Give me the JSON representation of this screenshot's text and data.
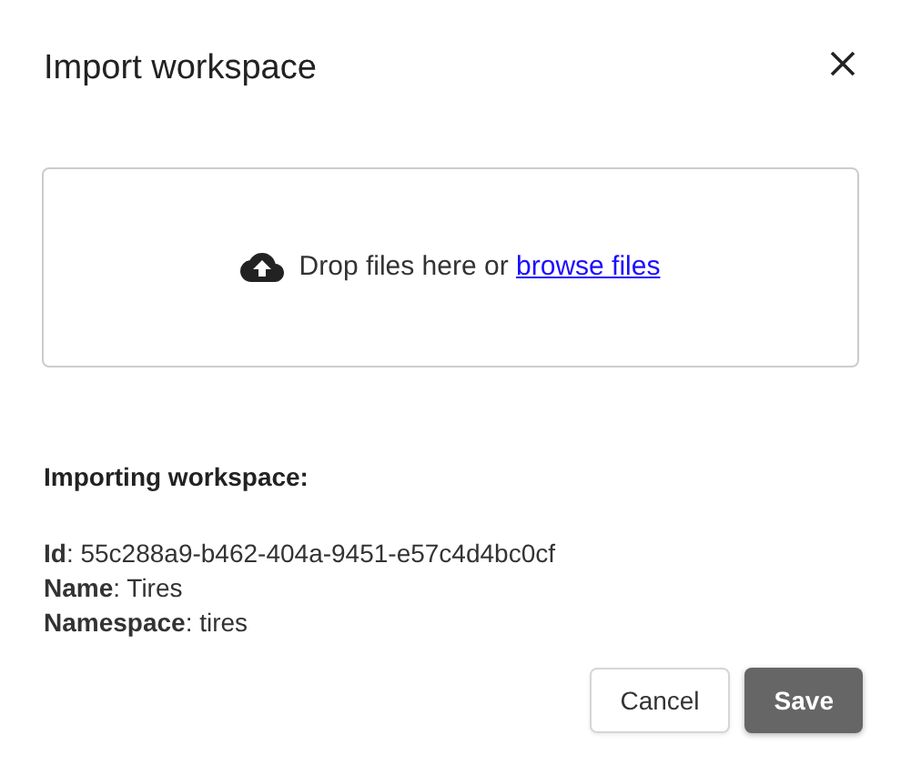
{
  "dialog": {
    "title": "Import workspace"
  },
  "dropzone": {
    "text": "Drop files here or",
    "link": "browse files"
  },
  "summary": {
    "heading": "Importing workspace:",
    "lines": [
      "**Id**: 55c288a9-b462-404a-9451-e57c4d4bc0cf",
      "**Name**: Tires",
      "**Namespace**: tires"
    ]
  },
  "buttons": [
    {
      "label": "Cancel",
      "kind": "secondary"
    },
    {
      "label": "Save",
      "kind": "primary"
    }
  ]
}
